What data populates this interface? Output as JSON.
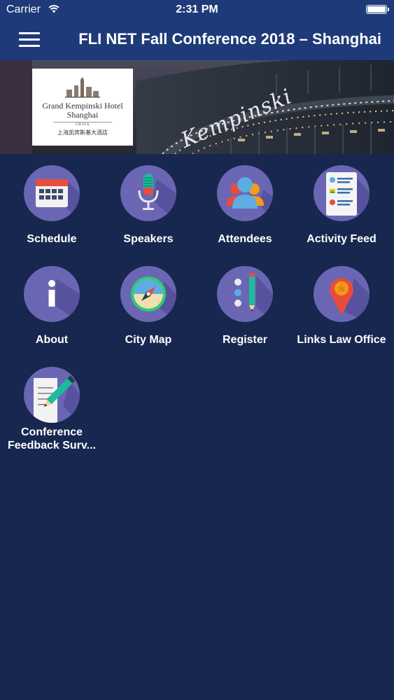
{
  "status_bar": {
    "carrier": "Carrier",
    "time": "2:31 PM"
  },
  "navbar": {
    "title": "FLI NET Fall Conference 2018 – Shanghai"
  },
  "banner": {
    "hotel_name_line1": "Grand Kempinski Hotel",
    "hotel_name_line2": "Shanghai",
    "hotel_country": "CHINA",
    "hotel_chinese": "上海凯宾斯基大酒店",
    "building_sign": "Kempinski"
  },
  "tiles": [
    {
      "label": "Schedule",
      "icon": "calendar-icon"
    },
    {
      "label": "Speakers",
      "icon": "microphone-icon"
    },
    {
      "label": "Attendees",
      "icon": "people-icon"
    },
    {
      "label": "Activity Feed",
      "icon": "activity-feed-icon"
    },
    {
      "label": "About",
      "icon": "info-icon"
    },
    {
      "label": "City Map",
      "icon": "compass-icon"
    },
    {
      "label": "Register",
      "icon": "checklist-icon"
    },
    {
      "label": "Links Law Office",
      "icon": "location-pin-icon"
    },
    {
      "label": "Conference Feedback Surv...",
      "icon": "survey-icon"
    }
  ],
  "colors": {
    "background": "#17274f",
    "navbar": "#1e3a78",
    "icon_circle": "#6a66b4"
  }
}
